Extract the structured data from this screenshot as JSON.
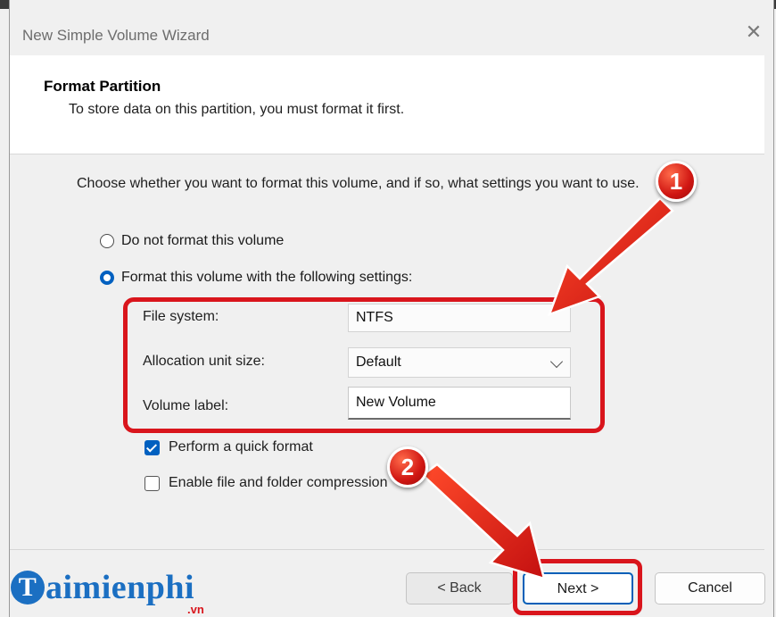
{
  "window": {
    "title": "New Simple Volume Wizard",
    "close_glyph": "✕"
  },
  "header": {
    "title": "Format Partition",
    "subtitle": "To store data on this partition, you must format it first."
  },
  "intro_text": "Choose whether you want to format this volume, and if so, what settings you want to use.",
  "options": {
    "no_format": {
      "label": "Do not format this volume",
      "selected": false
    },
    "format": {
      "label": "Format this volume with the following settings:",
      "selected": true
    }
  },
  "settings": {
    "file_system": {
      "label": "File system:",
      "value": "NTFS"
    },
    "allocation": {
      "label": "Allocation unit size:",
      "value": "Default"
    },
    "volume_label": {
      "label": "Volume label:",
      "value": "New Volume"
    }
  },
  "checkboxes": {
    "quick_format": {
      "label": "Perform a quick format",
      "checked": true
    },
    "compression": {
      "label": "Enable file and folder compression",
      "checked": false
    }
  },
  "buttons": {
    "back": "< Back",
    "next": "Next >",
    "cancel": "Cancel"
  },
  "annotations": {
    "badge_1": "1",
    "badge_2": "2"
  },
  "watermark": {
    "main": "aimienphi",
    "initial": "T",
    "suffix": ".vn"
  },
  "colors": {
    "accent": "#0060c0",
    "highlight": "#d9151c",
    "logo": "#1b6fc2"
  }
}
